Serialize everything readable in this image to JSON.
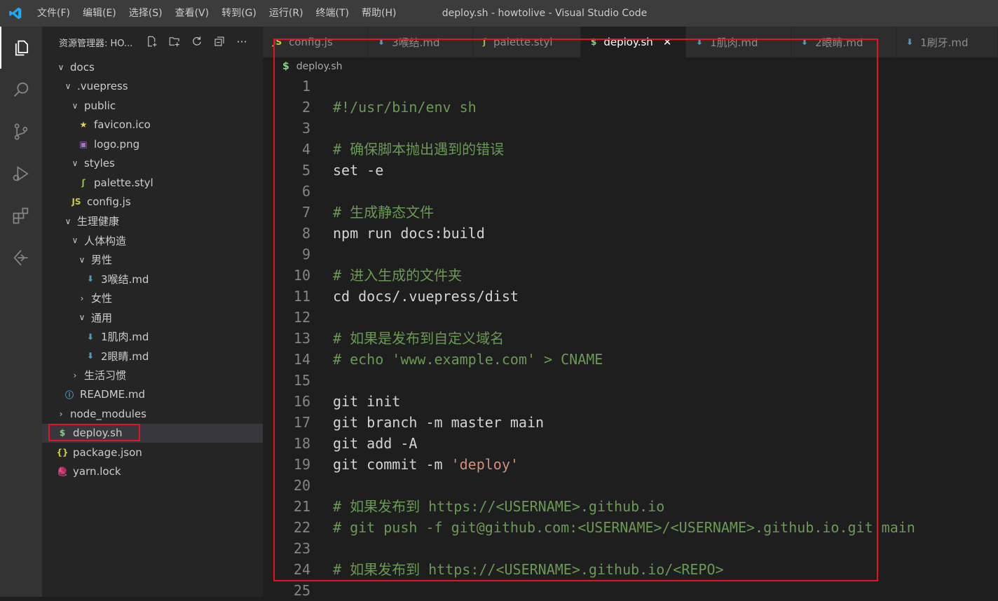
{
  "window": {
    "title": "deploy.sh - howtolive - Visual Studio Code"
  },
  "menu": [
    "文件(F)",
    "编辑(E)",
    "选择(S)",
    "查看(V)",
    "转到(G)",
    "运行(R)",
    "终端(T)",
    "帮助(H)"
  ],
  "sidebar": {
    "header": "资源管理器: HO...",
    "tree": [
      {
        "label": "docs",
        "chev": "∨",
        "icon": ""
      },
      {
        "label": ".vuepress",
        "chev": "∨",
        "icon": ""
      },
      {
        "label": "public",
        "chev": "∨",
        "icon": ""
      },
      {
        "label": "favicon.ico",
        "chev": "",
        "icon": "★"
      },
      {
        "label": "logo.png",
        "chev": "",
        "icon": "▣"
      },
      {
        "label": "styles",
        "chev": "∨",
        "icon": ""
      },
      {
        "label": "palette.styl",
        "chev": "",
        "icon": "ʃ"
      },
      {
        "label": "config.js",
        "chev": "",
        "icon": "JS"
      },
      {
        "label": "生理健康",
        "chev": "∨",
        "icon": ""
      },
      {
        "label": "人体构造",
        "chev": "∨",
        "icon": ""
      },
      {
        "label": "男性",
        "chev": "∨",
        "icon": ""
      },
      {
        "label": "3喉结.md",
        "chev": "",
        "icon": "⬇"
      },
      {
        "label": "女性",
        "chev": "›",
        "icon": ""
      },
      {
        "label": "通用",
        "chev": "∨",
        "icon": ""
      },
      {
        "label": "1肌肉.md",
        "chev": "",
        "icon": "⬇"
      },
      {
        "label": "2眼睛.md",
        "chev": "",
        "icon": "⬇"
      },
      {
        "label": "生活习惯",
        "chev": "›",
        "icon": ""
      },
      {
        "label": "README.md",
        "chev": "",
        "icon": "ⓘ"
      },
      {
        "label": "node_modules",
        "chev": "›",
        "icon": ""
      },
      {
        "label": "deploy.sh",
        "chev": "",
        "icon": "$"
      },
      {
        "label": "package.json",
        "chev": "",
        "icon": "{}"
      },
      {
        "label": "yarn.lock",
        "chev": "",
        "icon": "🧶"
      }
    ]
  },
  "tabs": [
    {
      "label": "config.js",
      "icon": "JS"
    },
    {
      "label": "3喉结.md",
      "icon": "⬇"
    },
    {
      "label": "palette.styl",
      "icon": "ʃ"
    },
    {
      "label": "deploy.sh",
      "icon": "$",
      "close": "✕"
    },
    {
      "label": "1肌肉.md",
      "icon": "⬇"
    },
    {
      "label": "2眼睛.md",
      "icon": "⬇"
    },
    {
      "label": "1刷牙.md",
      "icon": "⬇"
    }
  ],
  "breadcrumb": {
    "icon": "$",
    "file": "deploy.sh"
  },
  "code": [
    {
      "n": "1",
      "t": "",
      "k": "plain"
    },
    {
      "n": "2",
      "t": "#!/usr/bin/env sh",
      "k": "shebang"
    },
    {
      "n": "3",
      "t": "",
      "k": "plain"
    },
    {
      "n": "4",
      "t": "# 确保脚本抛出遇到的错误",
      "k": "comment"
    },
    {
      "n": "5",
      "t": "set -e",
      "k": "plain"
    },
    {
      "n": "6",
      "t": "",
      "k": "plain"
    },
    {
      "n": "7",
      "t": "# 生成静态文件",
      "k": "comment"
    },
    {
      "n": "8",
      "t": "npm run docs:build",
      "k": "plain"
    },
    {
      "n": "9",
      "t": "",
      "k": "plain"
    },
    {
      "n": "10",
      "t": "# 进入生成的文件夹",
      "k": "comment"
    },
    {
      "n": "11",
      "t": "cd docs/.vuepress/dist",
      "k": "plain"
    },
    {
      "n": "12",
      "t": "",
      "k": "plain"
    },
    {
      "n": "13",
      "t": "# 如果是发布到自定义域名",
      "k": "comment"
    },
    {
      "n": "14",
      "t": "# echo 'www.example.com' > CNAME",
      "k": "comment"
    },
    {
      "n": "15",
      "t": "",
      "k": "plain"
    },
    {
      "n": "16",
      "t": "git init",
      "k": "plain"
    },
    {
      "n": "17",
      "t": "git branch -m master main",
      "k": "plain"
    },
    {
      "n": "18",
      "t": "git add -A",
      "k": "plain"
    },
    {
      "n": "19",
      "t": "git commit -m ",
      "k": "plain",
      "str": "'deploy'"
    },
    {
      "n": "20",
      "t": "",
      "k": "plain"
    },
    {
      "n": "21",
      "t": "# 如果发布到 https://<USERNAME>.github.io",
      "k": "comment"
    },
    {
      "n": "22",
      "t": "# git push -f git@github.com:<USERNAME>/<USERNAME>.github.io.git main",
      "k": "comment"
    },
    {
      "n": "23",
      "t": "",
      "k": "plain"
    },
    {
      "n": "24",
      "t": "# 如果发布到 https://<USERNAME>.github.io/<REPO>",
      "k": "comment"
    },
    {
      "n": "25",
      "t": "",
      "k": "plain"
    }
  ],
  "colors": {
    "highlight_box": "#e81123",
    "accent": "#007acc"
  }
}
